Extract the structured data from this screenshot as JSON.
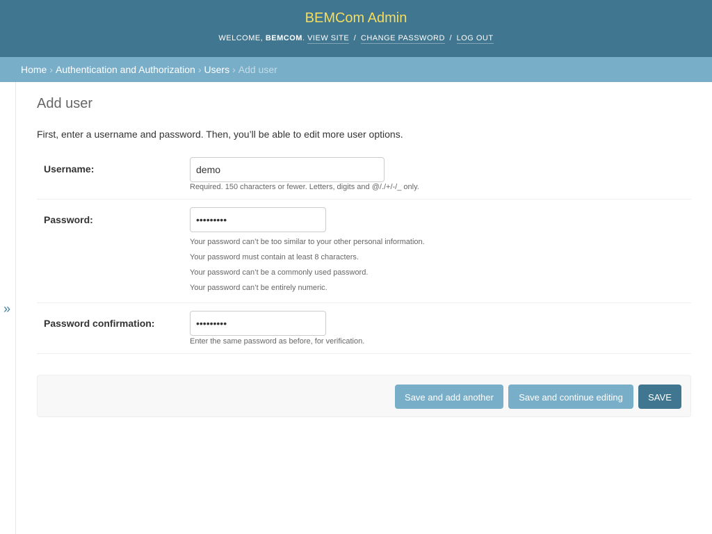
{
  "header": {
    "site_title": "BEMCom Admin",
    "welcome_prefix": "Welcome, ",
    "username": "BEMCom",
    "welcome_suffix": ".",
    "view_site": "View site",
    "change_password": "Change password",
    "log_out": "Log out",
    "separator": "/"
  },
  "breadcrumbs": {
    "items": [
      "Home",
      "Authentication and Authorization",
      "Users"
    ],
    "current": "Add user",
    "arrow": "›"
  },
  "sidebar": {
    "toggle_glyph": "»"
  },
  "page": {
    "title": "Add user",
    "intro": "First, enter a username and password. Then, you’ll be able to edit more user options."
  },
  "form": {
    "username": {
      "label": "Username:",
      "value": "demo",
      "help": "Required. 150 characters or fewer. Letters, digits and @/./+/-/_ only."
    },
    "password": {
      "label": "Password:",
      "value": "•••••••••",
      "help": [
        "Your password can’t be too similar to your other personal information.",
        "Your password must contain at least 8 characters.",
        "Your password can’t be a commonly used password.",
        "Your password can’t be entirely numeric."
      ]
    },
    "password_confirmation": {
      "label": "Password confirmation:",
      "value": "•••••••••",
      "help": "Enter the same password as before, for verification."
    }
  },
  "actions": {
    "save_add_another": "Save and add another",
    "save_continue": "Save and continue editing",
    "save": "SAVE"
  },
  "colors": {
    "header_bg": "#417690",
    "title_accent": "#f5dd5d",
    "breadcrumb_bg": "#79aec8",
    "button_light": "#79aec8",
    "button_primary": "#417690"
  }
}
